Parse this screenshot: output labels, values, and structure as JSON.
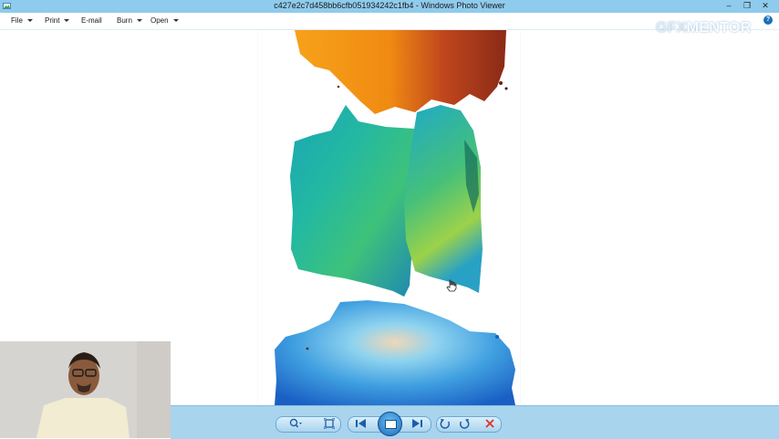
{
  "window": {
    "title": "c427e2c7d458bb6cfb051934242c1fb4 - Windows Photo Viewer",
    "controls": {
      "minimize": "–",
      "maximize": "❐",
      "close": "✕"
    }
  },
  "menu": {
    "items": [
      {
        "label": "File",
        "has_dropdown": true
      },
      {
        "label": "Print",
        "has_dropdown": true
      },
      {
        "label": "E-mail",
        "has_dropdown": false
      },
      {
        "label": "Burn",
        "has_dropdown": true
      },
      {
        "label": "Open",
        "has_dropdown": true
      }
    ],
    "help": "?"
  },
  "watermark": {
    "part1": "GFX",
    "part2": "MENTOR"
  },
  "toolbar": {
    "buttons": [
      {
        "name": "zoom-icon",
        "symbol": "⌕"
      },
      {
        "name": "actual-size-icon",
        "symbol": "▣"
      },
      {
        "name": "previous-icon",
        "symbol": "⏮"
      },
      {
        "name": "slideshow-icon",
        "symbol": "▣"
      },
      {
        "name": "next-icon",
        "symbol": "⏭"
      },
      {
        "name": "rotate-counterclockwise-icon",
        "symbol": "↺"
      },
      {
        "name": "rotate-clockwise-icon",
        "symbol": "↻"
      },
      {
        "name": "delete-icon",
        "symbol": "✕"
      }
    ]
  },
  "colors": {
    "titlebar": "#8fcbec",
    "statusbar": "#a8d4ee",
    "accent": "#1e5ea8",
    "delete": "#d9342b"
  }
}
